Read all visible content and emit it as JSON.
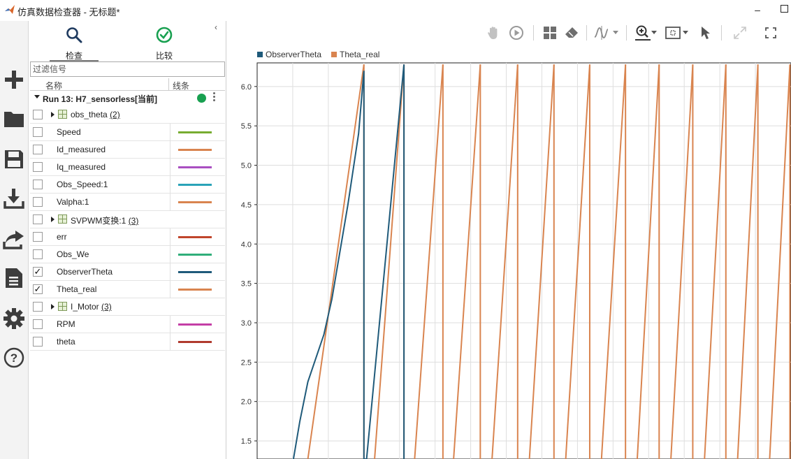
{
  "window": {
    "title": "仿真数据检查器 - 无标题*",
    "minimize_glyph": "–"
  },
  "left_rail": {
    "icons": [
      "add-icon",
      "folder-icon",
      "save-icon",
      "download-icon",
      "share-icon",
      "document-icon",
      "gear-icon",
      "help-icon"
    ],
    "help_glyph": "?"
  },
  "panel": {
    "tabs": [
      {
        "label": "检查",
        "icon": "search-icon"
      },
      {
        "label": "比较",
        "icon": "check-circle-icon"
      }
    ],
    "collapse_glyph": "‹",
    "filter_placeholder": "过滤信号",
    "columns": {
      "name": "名称",
      "line": "线条"
    },
    "run": {
      "label": "Run 13: H7_sensorless[当前]",
      "status_color": "#18a050"
    },
    "rows": [
      {
        "type": "group",
        "name": "obs_theta",
        "count": "(2)"
      },
      {
        "type": "signal",
        "name": "Speed",
        "checked": false,
        "color": "#77ac30"
      },
      {
        "type": "signal",
        "name": "Id_measured",
        "checked": false,
        "color": "#d9844f"
      },
      {
        "type": "signal",
        "name": "Iq_measured",
        "checked": false,
        "color": "#a94fc1"
      },
      {
        "type": "signal",
        "name": "Obs_Speed:1",
        "checked": false,
        "color": "#2aa3b8"
      },
      {
        "type": "signal",
        "name": "Valpha:1",
        "checked": false,
        "color": "#d9844f"
      },
      {
        "type": "group",
        "name": "SVPWM变换:1",
        "count": "(3)"
      },
      {
        "type": "signal",
        "name": "err",
        "checked": false,
        "color": "#c0452b"
      },
      {
        "type": "signal",
        "name": "Obs_We",
        "checked": false,
        "color": "#2fae7a"
      },
      {
        "type": "signal",
        "name": "ObserverTheta",
        "checked": true,
        "color": "#1f5a7a"
      },
      {
        "type": "signal",
        "name": "Theta_real",
        "checked": true,
        "color": "#d9844f"
      },
      {
        "type": "group",
        "name": "I_Motor",
        "count": "(3)"
      },
      {
        "type": "signal",
        "name": "RPM",
        "checked": false,
        "color": "#c43ea6"
      },
      {
        "type": "signal",
        "name": "theta",
        "checked": false,
        "color": "#b03a2e"
      }
    ],
    "check_glyph": "✓"
  },
  "toolbar": {
    "icons": [
      "pan-icon",
      "play-icon",
      "layout-icon",
      "eraser-icon",
      "cursor-wave-icon",
      "zoom-icon",
      "fit-box-icon",
      "pointer-icon",
      "expand-icon",
      "fullscreen-icon"
    ]
  },
  "chart_data": {
    "type": "line",
    "series": [
      {
        "name": "ObserverTheta",
        "color": "#1f5a7a"
      },
      {
        "name": "Theta_real",
        "color": "#d9844f"
      }
    ],
    "y_ticks": [
      "6.0",
      "5.5",
      "5.0",
      "4.5",
      "4.0",
      "3.5",
      "3.0",
      "2.5",
      "2.0",
      "1.5"
    ],
    "ylim": [
      1.27,
      6.3
    ],
    "grid": true,
    "legend_position": "top-left",
    "sawtooth_peak": 6.28,
    "ramp_start_x": [
      0.135,
      0.22,
      0.295,
      0.368,
      0.44,
      0.51,
      0.578,
      0.645,
      0.712,
      0.775,
      0.838,
      0.9,
      0.96
    ],
    "ramp_peak_x": [
      0.2,
      0.275,
      0.348,
      0.418,
      0.488,
      0.556,
      0.623,
      0.69,
      0.753,
      0.816,
      0.878,
      0.938,
      0.998
    ],
    "observer_curve": [
      [
        0.068,
        1.27
      ],
      [
        0.08,
        1.75
      ],
      [
        0.095,
        2.25
      ],
      [
        0.11,
        2.55
      ],
      [
        0.125,
        2.85
      ],
      [
        0.14,
        3.3
      ],
      [
        0.155,
        3.9
      ],
      [
        0.17,
        4.5
      ],
      [
        0.19,
        5.4
      ],
      [
        0.2,
        6.2
      ],
      [
        0.2,
        1.27
      ],
      [
        0.205,
        1.27
      ],
      [
        0.275,
        6.28
      ],
      [
        0.275,
        1.27
      ]
    ],
    "theta_real_curve": [
      [
        0.095,
        1.27
      ],
      [
        0.2,
        6.28
      ]
    ]
  }
}
